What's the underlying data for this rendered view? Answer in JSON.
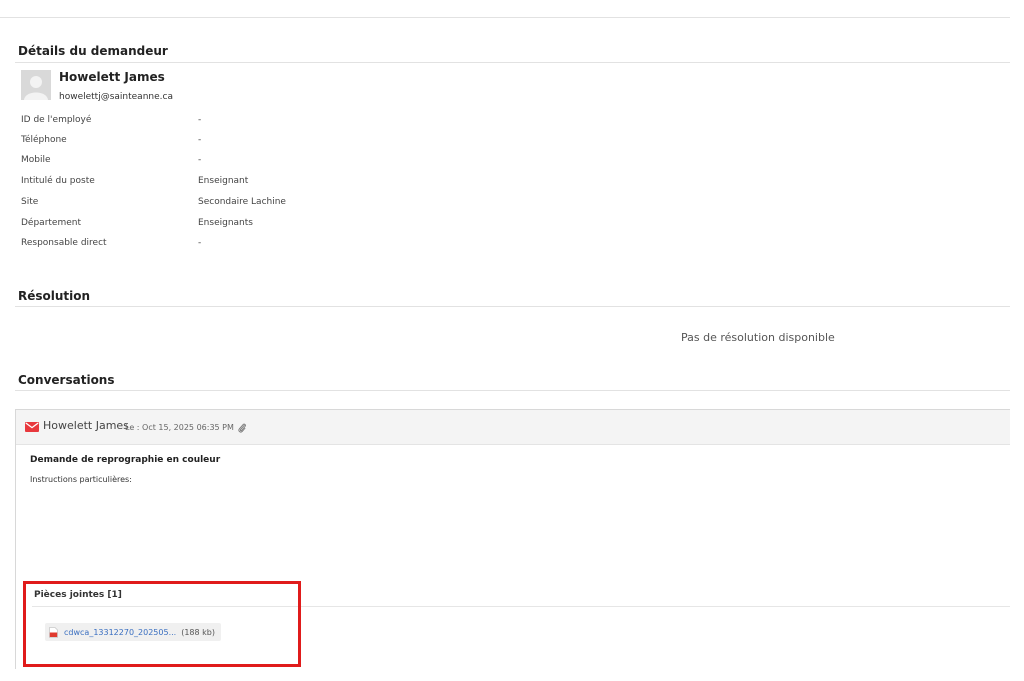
{
  "requester_section": {
    "title": "Détails du demandeur",
    "name": "Howelett James",
    "email": "howelettj@sainteanne.ca",
    "fields": [
      {
        "label": "ID de l'employé",
        "value": "-"
      },
      {
        "label": "Téléphone",
        "value": "-"
      },
      {
        "label": "Mobile",
        "value": "-"
      },
      {
        "label": "Intitulé du poste",
        "value": "Enseignant"
      },
      {
        "label": "Site",
        "value": "Secondaire Lachine"
      },
      {
        "label": "Département",
        "value": "Enseignants"
      },
      {
        "label": "Responsable direct",
        "value": "-"
      }
    ]
  },
  "resolution_section": {
    "title": "Résolution",
    "empty_text": "Pas de résolution disponible"
  },
  "conversations_section": {
    "title": "Conversations",
    "conversation": {
      "author": "Howelett James",
      "date": "Le : Oct 15, 2025 06:35 PM",
      "subject": "Demande de reprographie en couleur",
      "body": "Instructions particulières:",
      "attachments_title": "Pièces jointes [1]",
      "attachment": {
        "file_name": "cdwca_13312270_202505...",
        "size": "(188 kb)"
      }
    }
  },
  "colors": {
    "highlight": "#e01b1b",
    "mail_icon": "#e8383d",
    "link": "#3a6fc1"
  },
  "icons": [
    "avatar-placeholder-icon",
    "mail-icon",
    "paperclip-icon",
    "pdf-file-icon"
  ]
}
